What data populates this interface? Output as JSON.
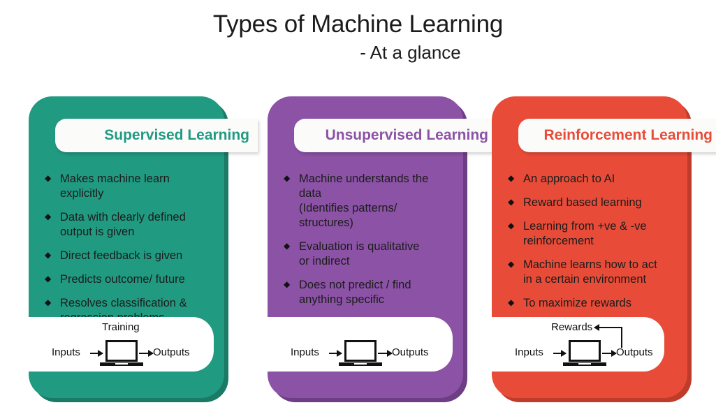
{
  "title": {
    "main": "Types of Machine Learning",
    "subtitle": "- At a glance"
  },
  "colors": {
    "supervised": "#209a81",
    "supervised_shadow": "#1a7a66",
    "unsupervised": "#8b52a6",
    "unsupervised_shadow": "#6d3e84",
    "reinforcement": "#e84c38",
    "reinforcement_shadow": "#bf3b2a",
    "background": "#ffffff",
    "band": "#fbfbfa",
    "text_dark": "#1c1c1c"
  },
  "cards": [
    {
      "id": "supervised",
      "header": "Supervised Learning",
      "bullet_glyph": "◆",
      "bullets": [
        "Makes machine learn explicitly",
        "Data with clearly defined\noutput is given",
        "Direct feedback is given",
        "Predicts outcome/ future",
        "Resolves classification &\nregression problems"
      ],
      "diagram": {
        "input_label": "Inputs",
        "output_label": "Outputs",
        "top_label": "Training",
        "has_feedback_loop": false,
        "device_icon": "laptop-icon"
      }
    },
    {
      "id": "unsupervised",
      "header": "Unsupervised Learning",
      "bullet_glyph": "◆",
      "bullets": [
        "Machine understands the data\n(Identifies patterns/ structures)",
        "Evaluation is qualitative\nor indirect",
        "Does not predict / find\nanything specific"
      ],
      "diagram": {
        "input_label": "Inputs",
        "output_label": "Outputs",
        "top_label": "",
        "has_feedback_loop": false,
        "device_icon": "laptop-icon"
      }
    },
    {
      "id": "reinforcement",
      "header": "Reinforcement Learning",
      "bullet_glyph": "◆",
      "bullets": [
        "An approach to AI",
        "Reward based learning",
        "Learning from +ve & -ve\nreinforcement",
        "Machine learns how to act\nin a certain environment",
        "To maximize rewards"
      ],
      "diagram": {
        "input_label": "Inputs",
        "output_label": "Outputs",
        "top_label": "Rewards",
        "has_feedback_loop": true,
        "device_icon": "laptop-icon"
      }
    }
  ]
}
